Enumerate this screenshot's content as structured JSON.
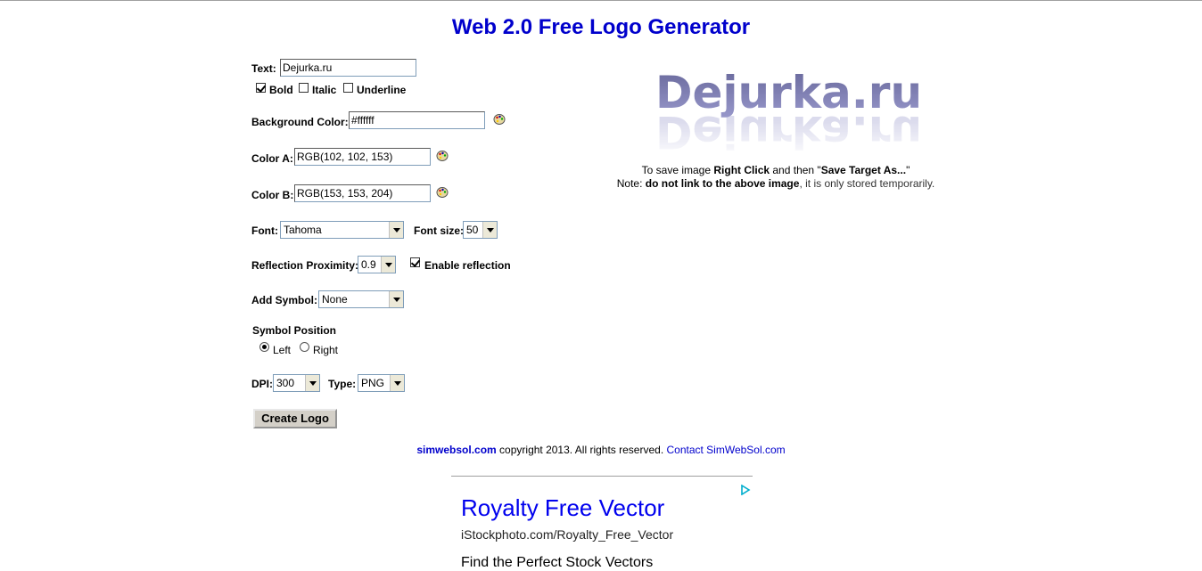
{
  "page": {
    "title": "Web 2.0 Free Logo Generator"
  },
  "form": {
    "text_label": "Text:",
    "text_value": "Dejurka.ru",
    "bold_label": "Bold",
    "bold_checked": true,
    "italic_label": "Italic",
    "italic_checked": false,
    "underline_label": "Underline",
    "underline_checked": false,
    "bg_color_label": "Background Color:",
    "bg_color_value": "#ffffff",
    "color_a_label": "Color A:",
    "color_a_value": "RGB(102, 102, 153)",
    "color_b_label": "Color B:",
    "color_b_value": "RGB(153, 153, 204)",
    "font_label": "Font:",
    "font_value": "Tahoma",
    "font_size_label": "Font size:",
    "font_size_value": "50",
    "reflection_label": "Reflection Proximity:",
    "reflection_value": "0.9",
    "enable_reflection_label": "Enable reflection",
    "enable_reflection_checked": true,
    "add_symbol_label": "Add Symbol:",
    "add_symbol_value": "None",
    "symbol_position_label": "Symbol Position",
    "left_label": "Left",
    "left_selected": true,
    "right_label": "Right",
    "right_selected": false,
    "dpi_label": "DPI:",
    "dpi_value": "300",
    "type_label": "Type:",
    "type_value": "PNG",
    "create_button": "Create Logo"
  },
  "preview": {
    "logo_text": "Dejurka.ru",
    "save_pre": "To save image ",
    "save_rc": "Right Click",
    "save_mid": " and then \"",
    "save_sta": "Save Target As...",
    "save_post": "\"",
    "note_pre": "Note: ",
    "note_bold": "do not link to the above image",
    "note_post": ", it is only stored temporarily."
  },
  "footer": {
    "site_link": "simwebsol.com",
    "copyright": " copyright 2013. All rights reserved. ",
    "contact_link": "Contact SimWebSol.com"
  },
  "ad": {
    "title": "Royalty Free Vector",
    "url": "iStockphoto.com/Royalty_Free_Vector",
    "desc": "Find the Perfect Stock Vectors"
  },
  "colors": {
    "title": "#0000cc",
    "link": "#0000cc",
    "logo_a": "#666699",
    "logo_b": "#9999cc"
  }
}
